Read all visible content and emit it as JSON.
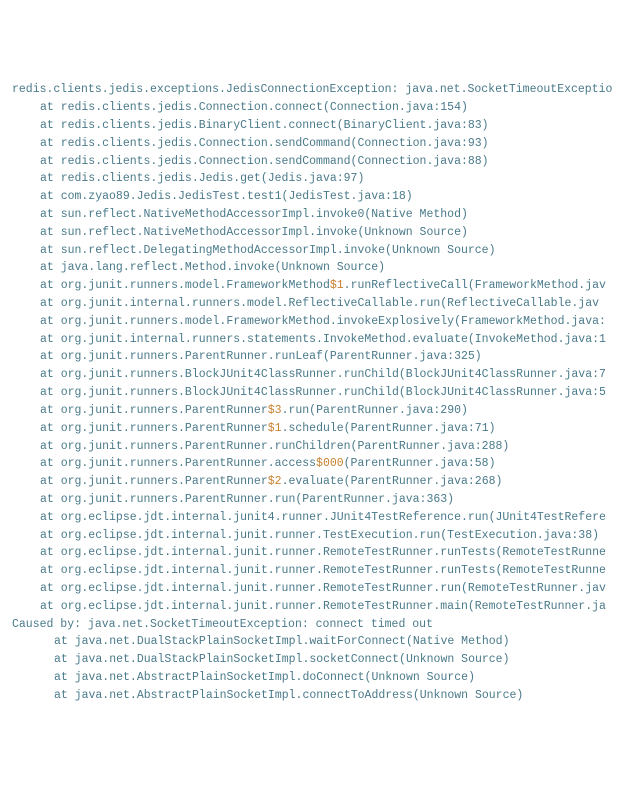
{
  "stacktrace": {
    "header": "redis.clients.jedis.exceptions.JedisConnectionException: java.net.SocketTimeoutExceptio",
    "frames": [
      {
        "text": "at redis.clients.jedis.Connection.connect(Connection.java:154)",
        "indent": 1
      },
      {
        "text": "at redis.clients.jedis.BinaryClient.connect(BinaryClient.java:83)",
        "indent": 1
      },
      {
        "text": "at redis.clients.jedis.Connection.sendCommand(Connection.java:93)",
        "indent": 1
      },
      {
        "text": "at redis.clients.jedis.Connection.sendCommand(Connection.java:88)",
        "indent": 1
      },
      {
        "text": "at redis.clients.jedis.Jedis.get(Jedis.java:97)",
        "indent": 1
      },
      {
        "text": "at com.zyao89.Jedis.JedisTest.test1(JedisTest.java:18)",
        "indent": 1
      },
      {
        "text": "at sun.reflect.NativeMethodAccessorImpl.invoke0(Native Method)",
        "indent": 1
      },
      {
        "text": "at sun.reflect.NativeMethodAccessorImpl.invoke(Unknown Source)",
        "indent": 1
      },
      {
        "text": "at sun.reflect.DelegatingMethodAccessorImpl.invoke(Unknown Source)",
        "indent": 1
      },
      {
        "text": "at java.lang.reflect.Method.invoke(Unknown Source)",
        "indent": 1
      },
      {
        "segments": [
          {
            "t": "at org.junit.runners.model.FrameworkMethod"
          },
          {
            "t": "$1",
            "hl": true
          },
          {
            "t": ".runReflectiveCall(FrameworkMethod.jav"
          }
        ],
        "indent": 1
      },
      {
        "text": "at org.junit.internal.runners.model.ReflectiveCallable.run(ReflectiveCallable.jav",
        "indent": 1
      },
      {
        "text": "at org.junit.runners.model.FrameworkMethod.invokeExplosively(FrameworkMethod.java:",
        "indent": 1
      },
      {
        "text": "at org.junit.internal.runners.statements.InvokeMethod.evaluate(InvokeMethod.java:1",
        "indent": 1
      },
      {
        "text": "at org.junit.runners.ParentRunner.runLeaf(ParentRunner.java:325)",
        "indent": 1
      },
      {
        "text": "at org.junit.runners.BlockJUnit4ClassRunner.runChild(BlockJUnit4ClassRunner.java:7",
        "indent": 1
      },
      {
        "text": "at org.junit.runners.BlockJUnit4ClassRunner.runChild(BlockJUnit4ClassRunner.java:5",
        "indent": 1
      },
      {
        "segments": [
          {
            "t": "at org.junit.runners.ParentRunner"
          },
          {
            "t": "$3",
            "hl": true
          },
          {
            "t": ".run(ParentRunner.java:290)"
          }
        ],
        "indent": 1
      },
      {
        "segments": [
          {
            "t": "at org.junit.runners.ParentRunner"
          },
          {
            "t": "$1",
            "hl": true
          },
          {
            "t": ".schedule(ParentRunner.java:71)"
          }
        ],
        "indent": 1
      },
      {
        "text": "at org.junit.runners.ParentRunner.runChildren(ParentRunner.java:288)",
        "indent": 1
      },
      {
        "segments": [
          {
            "t": "at org.junit.runners.ParentRunner.access"
          },
          {
            "t": "$000",
            "hl": true
          },
          {
            "t": "(ParentRunner.java:58)"
          }
        ],
        "indent": 1
      },
      {
        "segments": [
          {
            "t": "at org.junit.runners.ParentRunner"
          },
          {
            "t": "$2",
            "hl": true
          },
          {
            "t": ".evaluate(ParentRunner.java:268)"
          }
        ],
        "indent": 1
      },
      {
        "text": "at org.junit.runners.ParentRunner.run(ParentRunner.java:363)",
        "indent": 1
      },
      {
        "text": "at org.eclipse.jdt.internal.junit4.runner.JUnit4TestReference.run(JUnit4TestRefere",
        "indent": 1
      },
      {
        "text": "at org.eclipse.jdt.internal.junit.runner.TestExecution.run(TestExecution.java:38)",
        "indent": 1
      },
      {
        "text": "at org.eclipse.jdt.internal.junit.runner.RemoteTestRunner.runTests(RemoteTestRunne",
        "indent": 1
      },
      {
        "text": "at org.eclipse.jdt.internal.junit.runner.RemoteTestRunner.runTests(RemoteTestRunne",
        "indent": 1
      },
      {
        "text": "at org.eclipse.jdt.internal.junit.runner.RemoteTestRunner.run(RemoteTestRunner.jav",
        "indent": 1
      },
      {
        "text": "at org.eclipse.jdt.internal.junit.runner.RemoteTestRunner.main(RemoteTestRunner.ja",
        "indent": 1
      }
    ],
    "causedBy": "Caused by: java.net.SocketTimeoutException: connect timed out",
    "causedFrames": [
      {
        "text": "at java.net.DualStackPlainSocketImpl.waitForConnect(Native Method)",
        "indent": 2
      },
      {
        "text": "at java.net.DualStackPlainSocketImpl.socketConnect(Unknown Source)",
        "indent": 2
      },
      {
        "text": "at java.net.AbstractPlainSocketImpl.doConnect(Unknown Source)",
        "indent": 2
      },
      {
        "text": "at java.net.AbstractPlainSocketImpl.connectToAddress(Unknown Source)",
        "indent": 2
      }
    ]
  }
}
